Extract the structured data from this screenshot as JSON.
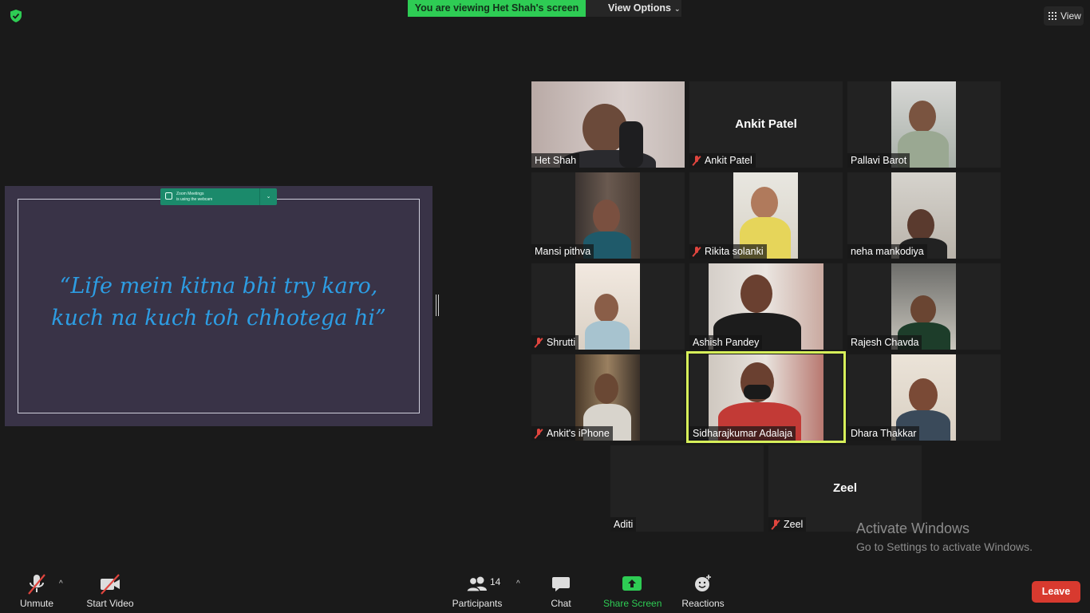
{
  "top": {
    "banner": "You are viewing Het Shah's screen",
    "view_options": "View Options",
    "view": "View"
  },
  "shared_screen": {
    "notification_line1": "Zoom Meetings",
    "notification_line2": "is using the webcam",
    "quote_line1": "“Life mein kitna bhi try karo,",
    "quote_line2": "kuch na kuch toh chhotega hi”"
  },
  "participants": [
    {
      "name": "Het Shah",
      "muted": false,
      "video": true
    },
    {
      "name": "Ankit Patel",
      "muted": true,
      "video": false
    },
    {
      "name": "Pallavi Barot",
      "muted": false,
      "video": true
    },
    {
      "name": "Mansi pithva",
      "muted": false,
      "video": true
    },
    {
      "name": "Rikita solanki",
      "muted": true,
      "video": true
    },
    {
      "name": "neha mankodiya",
      "muted": false,
      "video": true
    },
    {
      "name": "Shrutti",
      "muted": true,
      "video": true
    },
    {
      "name": "Ashish Pandey",
      "muted": false,
      "video": true
    },
    {
      "name": "Rajesh Chavda",
      "muted": false,
      "video": true
    },
    {
      "name": "Ankit's iPhone",
      "muted": true,
      "video": true
    },
    {
      "name": "Sidharajkumar Adalaja",
      "muted": false,
      "video": true,
      "active_speaker": true
    },
    {
      "name": "Dhara Thakkar",
      "muted": false,
      "video": true
    },
    {
      "name": "Aditi",
      "muted": false,
      "video": false
    },
    {
      "name": "Zeel",
      "muted": true,
      "video": false
    }
  ],
  "watermark": {
    "line1": "Activate Windows",
    "line2": "Go to Settings to activate Windows."
  },
  "toolbar": {
    "unmute": "Unmute",
    "start_video": "Start Video",
    "participants": "Participants",
    "participants_count": "14",
    "chat": "Chat",
    "share_screen": "Share Screen",
    "reactions": "Reactions",
    "leave": "Leave"
  },
  "colors": {
    "banner_green": "#2ecc54",
    "share_green": "#2ecc54",
    "leave_red": "#d83a2f",
    "active_speaker_border": "#d7f05a",
    "quote_blue": "#2d9de3"
  }
}
